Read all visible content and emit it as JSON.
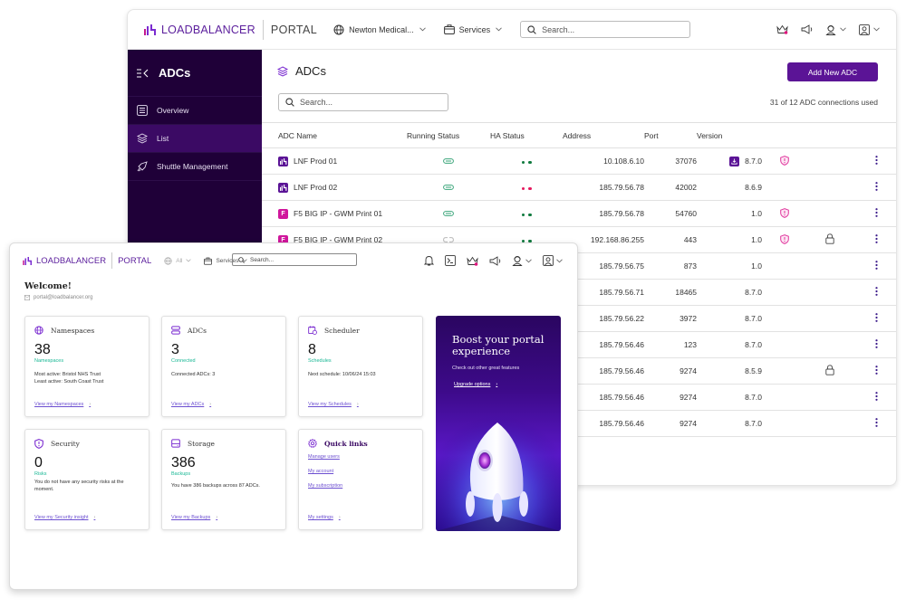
{
  "back_window": {
    "brand": "LOADBALANCER",
    "portal": "PORTAL",
    "namespace_selector": "Newton Medical...",
    "services_label": "Services",
    "search_placeholder": "Search...",
    "header_icons": [
      "crown-icon",
      "megaphone-icon",
      "support-agent-icon",
      "user-account-icon"
    ],
    "sidebar": {
      "title": "ADCs",
      "items": [
        {
          "label": "Overview",
          "icon": "list-icon",
          "active": false
        },
        {
          "label": "List",
          "icon": "layers-icon",
          "active": true
        },
        {
          "label": "Shuttle Management",
          "icon": "rocket-icon",
          "active": false
        }
      ]
    },
    "main": {
      "title": "ADCs",
      "add_button": "Add New ADC",
      "search_placeholder": "Search...",
      "usage": "31 of 12 ADC connections used",
      "columns": [
        "ADC Name",
        "Running Status",
        "HA Status",
        "Address",
        "Port",
        "Version"
      ],
      "rows": [
        {
          "vendor": "LB",
          "name": "LNF Prod 01",
          "running": "on",
          "ha": "green",
          "address": "10.108.6.10",
          "port": "37076",
          "version": "8.7.0",
          "update": true,
          "security_warning": true,
          "locked": false
        },
        {
          "vendor": "LB",
          "name": "LNF Prod 02",
          "running": "on",
          "ha": "red",
          "address": "185.79.56.78",
          "port": "42002",
          "version": "8.6.9",
          "update": false,
          "security_warning": false,
          "locked": false
        },
        {
          "vendor": "F",
          "name": "F5 BIG IP - GWM Print 01",
          "running": "on",
          "ha": "green",
          "address": "185.79.56.78",
          "port": "54760",
          "version": "1.0",
          "update": false,
          "security_warning": true,
          "locked": false
        },
        {
          "vendor": "F",
          "name": "F5 BIG IP - GWM Print 02",
          "running": "disconnected",
          "ha": "green",
          "address": "192.168.86.255",
          "port": "443",
          "version": "1.0",
          "update": false,
          "security_warning": true,
          "locked": true
        },
        {
          "address": "185.79.56.75",
          "port": "873",
          "version": "1.0",
          "locked": false
        },
        {
          "address": "185.79.56.71",
          "port": "18465",
          "version": "8.7.0",
          "locked": false
        },
        {
          "address": "185.79.56.22",
          "port": "3972",
          "version": "8.7.0",
          "locked": false
        },
        {
          "address": "185.79.56.46",
          "port": "123",
          "version": "8.7.0",
          "locked": false
        },
        {
          "address": "185.79.56.46",
          "port": "9274",
          "version": "8.5.9",
          "locked": true
        },
        {
          "address": "185.79.56.46",
          "port": "9274",
          "version": "8.7.0",
          "locked": false
        },
        {
          "address": "185.79.56.46",
          "port": "9274",
          "version": "8.7.0",
          "locked": false
        }
      ]
    }
  },
  "front_window": {
    "brand": "LOADBALANCER",
    "portal": "PORTAL",
    "namespace_selector": "All",
    "services_label": "Services",
    "search_placeholder": "Search...",
    "header_icons": [
      "bell-icon",
      "terminal-icon",
      "crown-icon",
      "megaphone-icon",
      "support-agent-icon",
      "user-account-icon"
    ],
    "welcome": "Welcome!",
    "email": "portal@loadbalancer.org",
    "cards": [
      {
        "title": "Namespaces",
        "value": "38",
        "sub": "Namespaces",
        "desc": "Most active: Bristol NHS Trust\nLeast active: South Coast Trust",
        "link": "View my Namespaces"
      },
      {
        "title": "ADCs",
        "value": "3",
        "sub": "Connected",
        "desc": "Connected ADCs: 3",
        "link": "View my ADCs"
      },
      {
        "title": "Scheduler",
        "value": "8",
        "sub": "Schedules",
        "desc": "Next schedule: 10/06/24 15:03",
        "link": "View my Schedules"
      },
      {
        "title": "Security",
        "value": "0",
        "sub": "Risks",
        "desc": "You do not have any security risks at the moment.",
        "link": "View my Security insight"
      },
      {
        "title": "Storage",
        "value": "386",
        "sub": "Backups",
        "desc": "You have 386 backups across 87 ADCs.",
        "link": "View my Backups"
      }
    ],
    "quick_links": {
      "title": "Quick links",
      "links": [
        "Manage users",
        "My account",
        "My subscription"
      ],
      "footer_link": "My settings"
    },
    "promo": {
      "title": "Boost your portal experience",
      "desc": "Check out other great features",
      "link": "Upgrade options"
    }
  },
  "colors": {
    "brand_purple": "#5b1496",
    "sidebar_bg": "#1f0038",
    "sidebar_active": "#3b0a64",
    "f5_pink": "#d0179c",
    "ha_green": "#107a3e",
    "ha_red": "#e5195e",
    "teal": "#18b794",
    "link": "#6c4fd1"
  }
}
